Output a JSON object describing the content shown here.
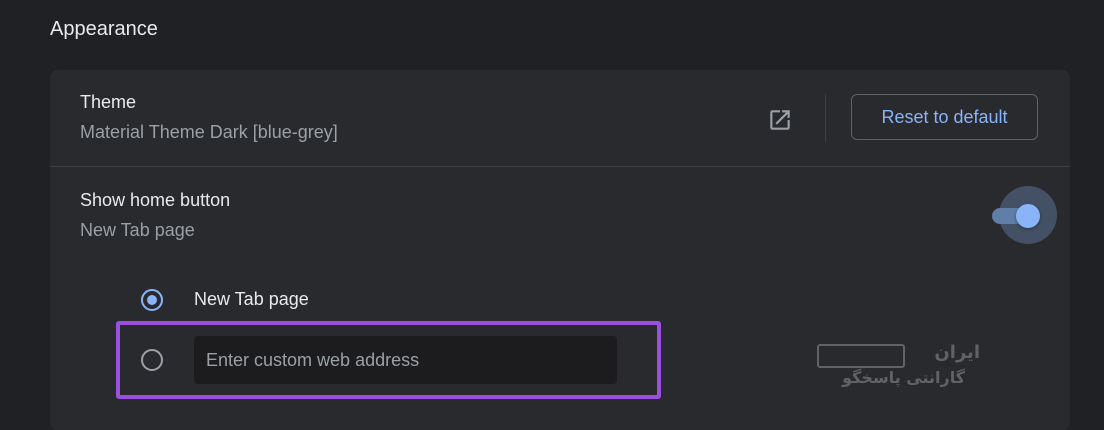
{
  "section": {
    "title": "Appearance"
  },
  "theme": {
    "label": "Theme",
    "value": "Material Theme Dark [blue-grey]",
    "open_icon": "open-in-new-icon",
    "reset_label": "Reset to default"
  },
  "home_button": {
    "label": "Show home button",
    "value": "New Tab page",
    "enabled": true,
    "options": [
      {
        "label": "New Tab page",
        "selected": true
      },
      {
        "label": "",
        "selected": false
      }
    ],
    "custom_address_placeholder": "Enter custom web address"
  },
  "watermark": {
    "line1": "ایران",
    "line2": "گارانتی پاسخگو"
  },
  "colors": {
    "accent": "#8ab4f8",
    "highlight": "#9b4fe0",
    "card_bg": "#292a2d",
    "page_bg": "#202124"
  }
}
